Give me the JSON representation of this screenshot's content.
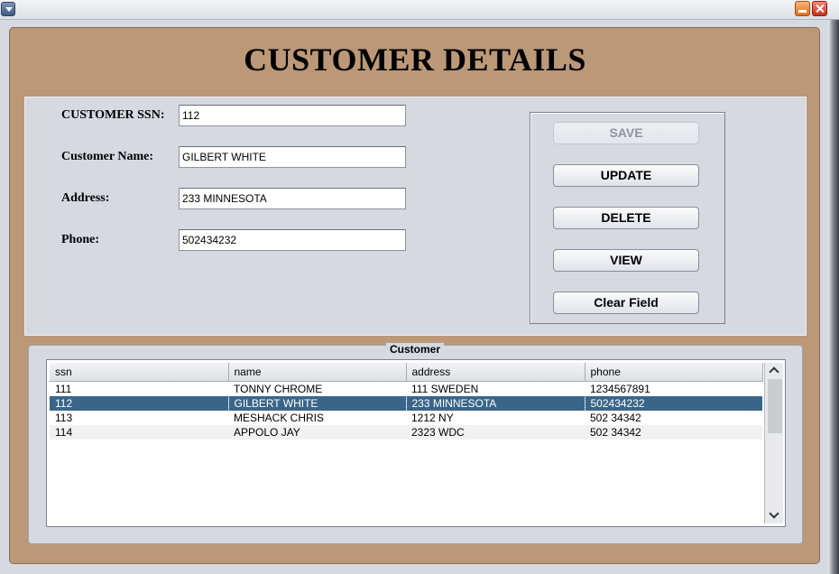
{
  "window": {
    "title": ""
  },
  "page": {
    "title": "CUSTOMER DETAILS"
  },
  "form": {
    "ssn_label": "CUSTOMER SSN:",
    "ssn_value": "112",
    "name_label": "Customer Name:",
    "name_value": "GILBERT WHITE",
    "address_label": "Address:",
    "address_value": "233 MINNESOTA",
    "phone_label": "Phone:",
    "phone_value": "502434232"
  },
  "buttons": {
    "save": "SAVE",
    "update": "UPDATE",
    "delete": "DELETE",
    "view": "VIEW",
    "clear": "Clear Field"
  },
  "table": {
    "caption": "Customer",
    "columns": [
      "ssn",
      "name",
      "address",
      "phone"
    ],
    "rows": [
      [
        "111",
        "TONNY CHROME",
        "111 SWEDEN",
        "1234567891"
      ],
      [
        "112",
        "GILBERT WHITE",
        "233 MINNESOTA",
        "502434232"
      ],
      [
        "113",
        "MESHACK CHRIS",
        "1212 NY",
        "502 34342"
      ],
      [
        "114",
        "APPOLO JAY",
        "2323 WDC",
        "502 34342"
      ]
    ],
    "selected_row": 1
  },
  "icons": [
    "system-menu-icon",
    "minimize-icon",
    "close-icon",
    "scroll-up-icon",
    "scroll-down-icon"
  ],
  "colors": {
    "frame": "#bb9878",
    "panel": "#d6d9e0",
    "selection": "#3a6588"
  }
}
